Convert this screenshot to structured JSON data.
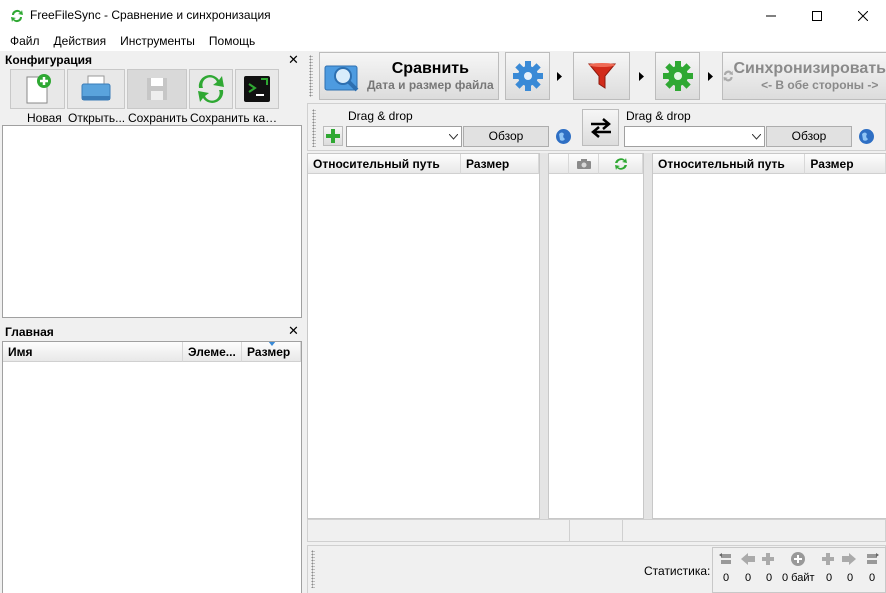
{
  "window": {
    "title": "FreeFileSync - Сравнение и синхронизация"
  },
  "menu": [
    "Файл",
    "Действия",
    "Инструменты",
    "Помощь"
  ],
  "config_panel": {
    "title": "Конфигурация",
    "buttons": [
      "Новая",
      "Открыть...",
      "Сохранить",
      "Сохранить как...",
      ""
    ]
  },
  "main_panel": {
    "title": "Главная",
    "columns": [
      "Имя",
      "Элеме...",
      "Размер"
    ]
  },
  "toolbar": {
    "compare_title": "Сравнить",
    "compare_sub": "Дата и размер файла",
    "sync_title": "Синхронизировать",
    "sync_sub": "<- В обе стороны ->"
  },
  "folders": {
    "left_label": "Drag & drop",
    "right_label": "Drag & drop",
    "browse": "Обзор"
  },
  "grid": {
    "left_columns": [
      "Относительный путь",
      "Размер"
    ],
    "right_columns": [
      "Относительный путь",
      "Размер"
    ]
  },
  "stats": {
    "label": "Статистика:",
    "values": [
      "0",
      "0",
      "0",
      "0 байт",
      "0",
      "0",
      "0"
    ]
  },
  "colors": {
    "accent": "#3a8ad6",
    "green": "#2fa833",
    "filter": "#d22b1a"
  }
}
